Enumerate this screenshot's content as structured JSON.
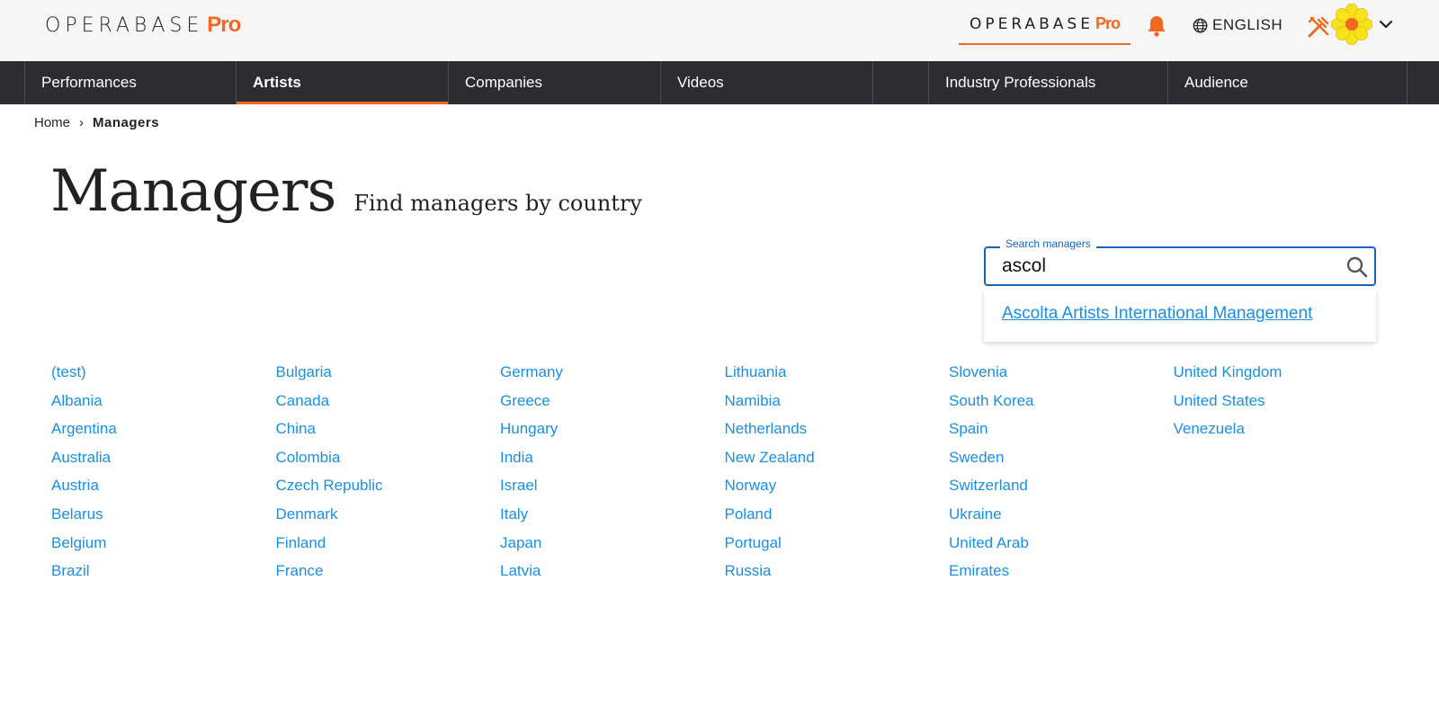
{
  "header": {
    "logo_text": "OPERABASE",
    "logo_pro": "Pro",
    "pro_link_text": "OPERABASE",
    "pro_link_pro": "Pro",
    "language": "ENGLISH"
  },
  "nav": {
    "items": [
      {
        "label": "Performances",
        "active": false
      },
      {
        "label": "Artists",
        "active": true
      },
      {
        "label": "Companies",
        "active": false
      },
      {
        "label": "Videos",
        "active": false
      },
      {
        "label": "",
        "active": false
      },
      {
        "label": "Industry Professionals",
        "active": false
      },
      {
        "label": "Audience",
        "active": false
      }
    ]
  },
  "breadcrumb": {
    "home": "Home",
    "separator": "›",
    "current": "Managers"
  },
  "page": {
    "title": "Managers",
    "subtitle": "Find managers by country"
  },
  "search": {
    "label": "Search managers",
    "value": "ascol",
    "suggestions": [
      "Ascolta Artists International Management"
    ]
  },
  "countries": {
    "columns": [
      [
        "(test)",
        "Albania",
        "Argentina",
        "Australia",
        "Austria",
        "Belarus",
        "Belgium",
        "Brazil"
      ],
      [
        "Bulgaria",
        "Canada",
        "China",
        "Colombia",
        "Czech Republic",
        "Denmark",
        "Finland",
        "France"
      ],
      [
        "Germany",
        "Greece",
        "Hungary",
        "India",
        "Israel",
        "Italy",
        "Japan",
        "Latvia"
      ],
      [
        "Lithuania",
        "Namibia",
        "Netherlands",
        "New Zealand",
        "Norway",
        "Poland",
        "Portugal",
        "Russia"
      ],
      [
        "Slovenia",
        "South Korea",
        "Spain",
        "Sweden",
        "Switzerland",
        "Ukraine",
        "United Arab",
        "Emirates"
      ],
      [
        "United Kingdom",
        "United States",
        "Venezuela"
      ]
    ]
  },
  "colors": {
    "accent": "#f26722",
    "nav_bg": "#2c2c31",
    "link": "#1a8fe3",
    "focus": "#1565c0"
  },
  "icons": [
    "bell-icon",
    "globe-icon",
    "tools-icon",
    "flower-avatar",
    "chevron-down-icon",
    "search-icon"
  ]
}
